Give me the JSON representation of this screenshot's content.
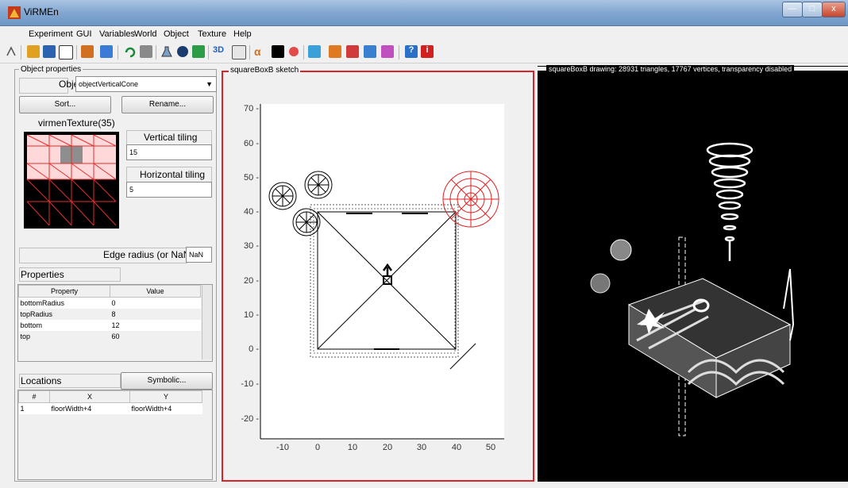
{
  "window": {
    "title": "ViRMEn",
    "min": "—",
    "max": "□",
    "close": "x"
  },
  "menu": [
    "Experiment",
    "GUI",
    "Variables",
    "World",
    "Object",
    "Texture",
    "Help"
  ],
  "object_properties": {
    "group_label": "Object properties",
    "object_label": "Object",
    "object_value": "objectVerticalCone",
    "sort_button": "Sort...",
    "rename_button": "Rename...",
    "texture_label": "virmenTexture(35)",
    "vertical_tiling_label": "Vertical tiling",
    "vertical_tiling_value": "15",
    "horizontal_tiling_label": "Horizontal tiling",
    "horizontal_tiling_value": "5",
    "edge_radius_label": "Edge radius (or NaN)",
    "edge_radius_value": "NaN"
  },
  "properties": {
    "group_label": "Properties",
    "headers": [
      "Property",
      "Value"
    ],
    "rows": [
      [
        "bottomRadius",
        "0"
      ],
      [
        "topRadius",
        "8"
      ],
      [
        "bottom",
        "12"
      ],
      [
        "top",
        "60"
      ]
    ]
  },
  "locations": {
    "group_label": "Locations",
    "symbolic_button": "Symbolic...",
    "headers": [
      "#",
      "X",
      "Y"
    ],
    "rows": [
      [
        "1",
        "floorWidth+4",
        "floorWidth+4"
      ]
    ]
  },
  "sketch": {
    "label": "squareBoxB sketch",
    "xticks": [
      "-10",
      "0",
      "10",
      "20",
      "30",
      "40",
      "50"
    ],
    "yticks": [
      "70 -",
      "60 -",
      "50 -",
      "40 -",
      "30 -",
      "20 -",
      "10 -",
      "0 -",
      "-10 -",
      "-20 -"
    ]
  },
  "drawing": {
    "label": "squareBoxB drawing: 28931 triangles, 17767 vertices, transparency disabled"
  },
  "colors": {
    "accent_red": "#d8232a",
    "title_blue": "#7fa4cf"
  }
}
